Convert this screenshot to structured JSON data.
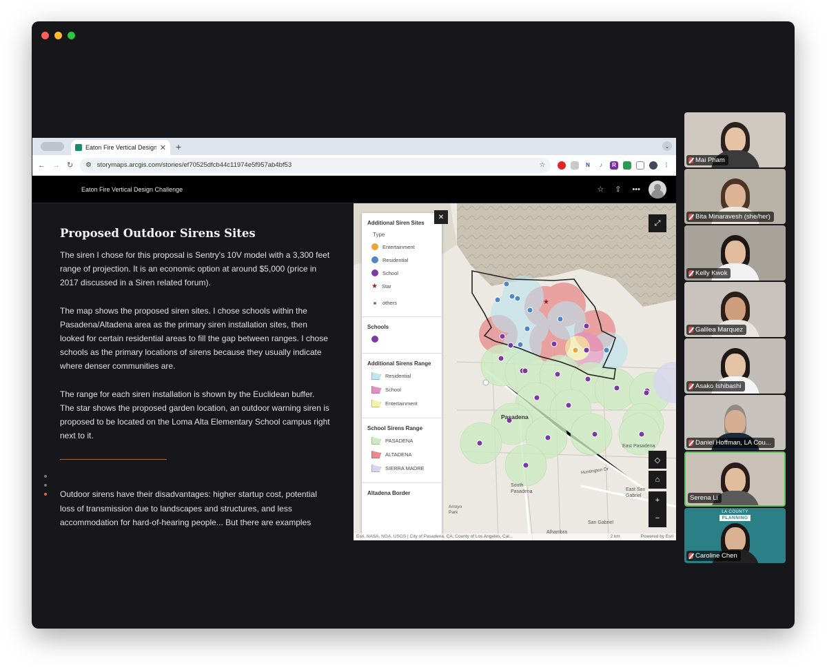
{
  "browser": {
    "tab_title": "Eaton Fire Vertical Design Ch",
    "url": "storymaps.arcgis.com/stories/ef70525dfcb44c11974e5f957ab4bf53"
  },
  "storymap": {
    "header_title": "Eaton Fire Vertical Design Challenge",
    "heading": "Proposed Outdoor Sirens Sites",
    "paragraphs": [
      "The siren I chose for this proposal is Sentry's 10V model with a 3,300 feet range of projection. It is an economic option at around $5,000 (price in 2017 discussed in a Siren related forum).",
      "The map shows the proposed siren sites. I chose schools within the Pasadena/Altadena area as the primary siren installation sites, then looked for certain residential areas to fill the gap between ranges. I chose schools as the primary locations of sirens because they usually indicate where denser communities are.",
      "The range for each siren installation is shown by the Euclidean buffer. The star shows the proposed garden location, an outdoor warning siren is proposed to be located on the Loma Alta Elementary School campus right next to it.",
      "Outdoor sirens have their disadvantages: higher startup cost, potential loss of transmission due to landscapes and structures, and less accommodation for hard-of-hearing people... But there are examples"
    ]
  },
  "legend": {
    "sections": [
      {
        "title": "Additional Siren Sites",
        "subtitle": "Type",
        "items": [
          {
            "label": "Entertainment",
            "color": "#e8a33a"
          },
          {
            "label": "Residential",
            "color": "#4f86c6"
          },
          {
            "label": "School",
            "color": "#7a3aa0"
          },
          {
            "label": "Star",
            "color": "#9b1c1c"
          },
          {
            "label": "others",
            "color": "#777777"
          }
        ]
      },
      {
        "title": "Schools",
        "subtitle": "",
        "items": [
          {
            "label": "",
            "color": "#7a3aa0"
          }
        ]
      },
      {
        "title": "Additional Sirens Range",
        "subtitle": "",
        "items": [
          {
            "label": "Residential",
            "color": "#bfe6f2"
          },
          {
            "label": "School",
            "color": "#e48fc4"
          },
          {
            "label": "Entertainment",
            "color": "#f6f3a8"
          }
        ]
      },
      {
        "title": "School Sirens Range",
        "subtitle": "",
        "items": [
          {
            "label": "PASADENA",
            "color": "#cdebc3"
          },
          {
            "label": "ALTADENA",
            "color": "#e98a8a"
          },
          {
            "label": "SIERRA MADRE",
            "color": "#d9d4f0"
          }
        ]
      },
      {
        "title": "Altadena Border",
        "subtitle": "",
        "items": []
      }
    ]
  },
  "map": {
    "labels": [
      {
        "text": "Pasadena"
      },
      {
        "text": "East Pasadena"
      },
      {
        "text": "South Pasadena"
      },
      {
        "text": "San Gabriel"
      },
      {
        "text": "Alhambra"
      },
      {
        "text": "East San Gabriel"
      },
      {
        "text": "Huntington Dr"
      },
      {
        "text": "Arroyo Park"
      }
    ],
    "attribution": "Esri, NASA, NGA, USGS | City of Pasadena, CA, County of Los Angeles, Cal...",
    "scale": "2 km",
    "powered": "Powered by Esri"
  },
  "participants": [
    {
      "name": "Mai Pham",
      "bg": "#cfc8c1",
      "skin": "#e7c3a6",
      "hair": "#2b2220",
      "shirt": "#3b3b3b"
    },
    {
      "name": "Bita Minaravesh (she/her)",
      "bg": "#b8b2a6",
      "skin": "#dcb394",
      "hair": "#4a3526",
      "shirt": "#ece6dc"
    },
    {
      "name": "Kelly Kwok",
      "bg": "#a7a39b",
      "skin": "#e2bc9c",
      "hair": "#1d1715",
      "shirt": "#f1f1f1"
    },
    {
      "name": "Galilea Marquez",
      "bg": "#c8c3bd",
      "skin": "#cf9e7e",
      "hair": "#2c1f18",
      "shirt": "#e9e4de"
    },
    {
      "name": "Asako Ishibashi",
      "bg": "#c2bcb6",
      "skin": "#e4c2a5",
      "hair": "#1e1816",
      "shirt": "#f4f4f4"
    },
    {
      "name": "Daniel Hoffman, LA Cou...",
      "bg": "#c7c2bb",
      "skin": "#d8ae92",
      "hair": "#8f8a84",
      "shirt": "#1d2a3a"
    },
    {
      "name": "Serena Li",
      "bg": "#c9c1b8",
      "skin": "#e1bc9d",
      "hair": "#2a1d19",
      "shirt": "#5a5a5a"
    },
    {
      "name": "Caroline Chen",
      "bg": "#2b7f86",
      "skin": "#d8b293",
      "hair": "#1c1614",
      "shirt": "#222222"
    }
  ],
  "lacp": {
    "top": "LA COUNTY",
    "bottom": "PLANNING"
  }
}
